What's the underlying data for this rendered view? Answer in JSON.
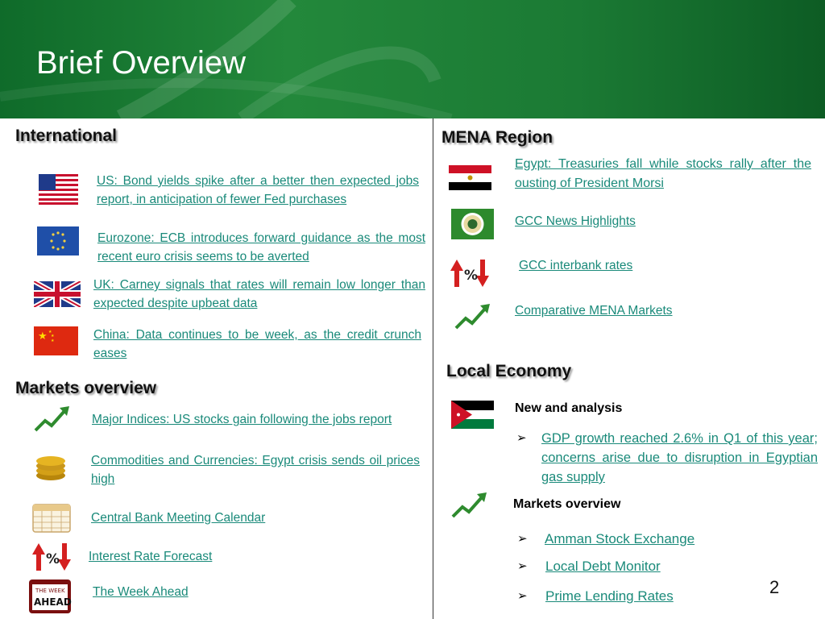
{
  "header": {
    "title": "Brief Overview"
  },
  "international": {
    "heading": "International",
    "items": [
      {
        "icon": "us-flag-icon",
        "text": "US: Bond yields spike after a better then expected jobs report, in anticipation of fewer Fed purchases"
      },
      {
        "icon": "eu-flag-icon",
        "text": "Eurozone: ECB introduces forward guidance as the most recent euro crisis seems to be averted"
      },
      {
        "icon": "uk-flag-icon",
        "text": "UK: Carney signals that rates will remain low longer than expected despite upbeat data"
      },
      {
        "icon": "china-flag-icon",
        "text": "China: Data continues to be week, as the credit crunch eases"
      }
    ]
  },
  "markets_overview": {
    "heading": "Markets overview",
    "items": [
      {
        "icon": "trend-up-icon",
        "text": "Major Indices: US stocks gain following the jobs report"
      },
      {
        "icon": "gold-coins-icon",
        "text": "Commodities and Currencies: Egypt crisis sends oil prices high"
      },
      {
        "icon": "calendar-icon",
        "text": "Central Bank Meeting Calendar"
      },
      {
        "icon": "interest-rate-icon",
        "text": "Interest Rate Forecast"
      },
      {
        "icon": "week-ahead-icon",
        "text": "The Week Ahead"
      }
    ]
  },
  "mena": {
    "heading": "MENA Region",
    "items": [
      {
        "icon": "egypt-flag-icon",
        "text": "Egypt: Treasuries fall while stocks rally after the ousting of President Morsi"
      },
      {
        "icon": "gcc-emblem-icon",
        "text": "GCC News Highlights"
      },
      {
        "icon": "interest-rate-icon",
        "text": "GCC interbank rates"
      },
      {
        "icon": "trend-up-icon",
        "text": "Comparative MENA Markets"
      }
    ]
  },
  "local_economy": {
    "heading": "Local Economy",
    "news_label": "New and analysis",
    "news_item": "GDP growth reached 2.6% in Q1 of this year; concerns arise due to disruption in Egyptian gas supply",
    "markets_label": "Markets overview",
    "market_items": [
      "Amman Stock Exchange",
      "Local Debt Monitor",
      "Prime Lending Rates"
    ],
    "bullet_glyph": "➢"
  },
  "page_number": "2",
  "colors": {
    "header_green": "#1b7a34",
    "link": "#1a8a7a"
  }
}
